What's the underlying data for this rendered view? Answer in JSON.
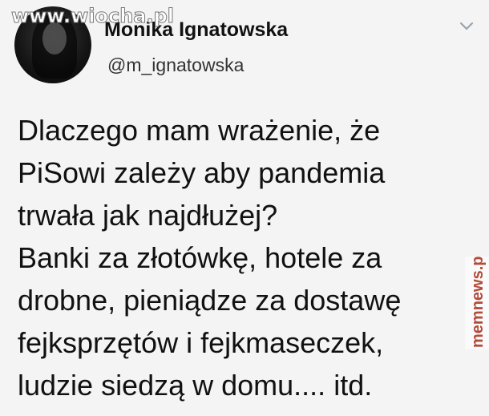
{
  "watermark_top": "www.wiocha.pl",
  "profile": {
    "display_name": "Monika Ignatowska",
    "handle": "@m_ignatowska"
  },
  "tweet": {
    "lines": [
      "Dlaczego mam wrażenie, że",
      "PiSowi zależy aby pandemia",
      "trwała jak najdłużej?",
      "Banki za złotówkę, hotele za",
      "drobne, pieniądze za dostawę",
      "fejksprzętów i fejkmaseczek,",
      "ludzie siedzą w domu.... itd."
    ]
  },
  "watermark_side": "memnews.pl",
  "icons": {
    "menu": "chevron-down-icon"
  },
  "colors": {
    "background": "#f4f4f4",
    "text": "#111111",
    "handle": "#333333",
    "chevron": "#9aa4ad"
  }
}
